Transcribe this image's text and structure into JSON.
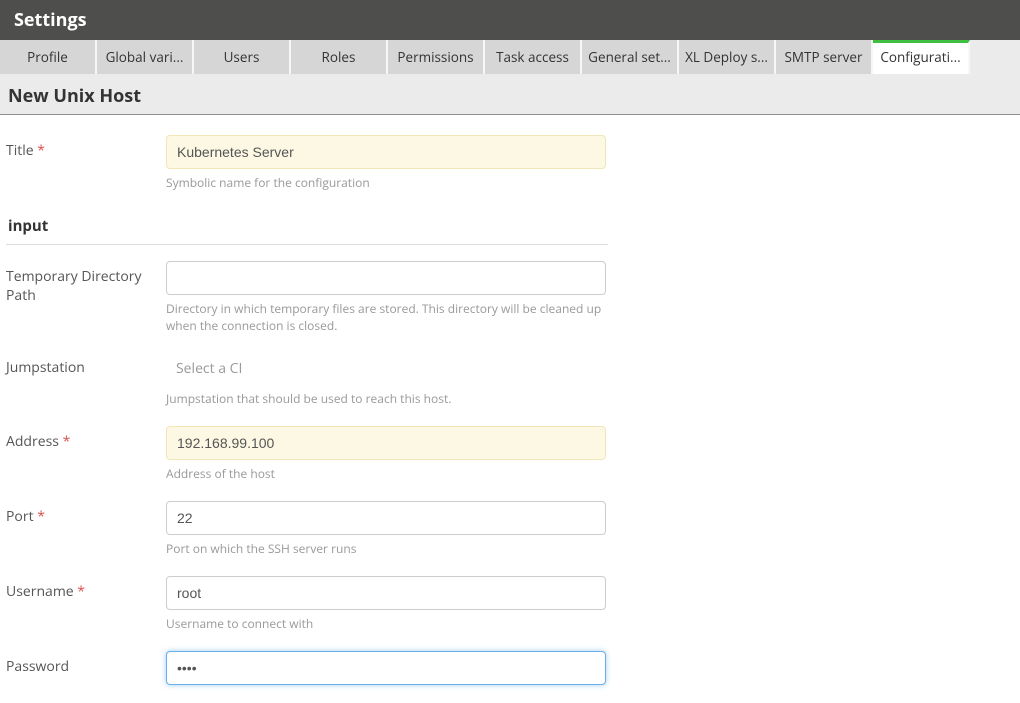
{
  "header": {
    "title": "Settings"
  },
  "tabs": [
    {
      "label": "Profile",
      "active": false
    },
    {
      "label": "Global vari...",
      "active": false
    },
    {
      "label": "Users",
      "active": false
    },
    {
      "label": "Roles",
      "active": false
    },
    {
      "label": "Permissions",
      "active": false
    },
    {
      "label": "Task access",
      "active": false
    },
    {
      "label": "General set...",
      "active": false
    },
    {
      "label": "XL Deploy s...",
      "active": false
    },
    {
      "label": "SMTP server",
      "active": false
    },
    {
      "label": "Configurati...",
      "active": true
    }
  ],
  "page": {
    "title": "New Unix Host"
  },
  "form": {
    "title": {
      "label": "Title",
      "required": true,
      "value": "Kubernetes Server",
      "help": "Symbolic name for the configuration"
    },
    "section_input": "input",
    "tmpDir": {
      "label": "Temporary Directory Path",
      "required": false,
      "value": "",
      "help": "Directory in which temporary files are stored. This directory will be cleaned up when the connection is closed."
    },
    "jumpstation": {
      "label": "Jumpstation",
      "required": false,
      "placeholder": "Select a CI",
      "help": "Jumpstation that should be used to reach this host."
    },
    "address": {
      "label": "Address",
      "required": true,
      "value": "192.168.99.100",
      "help": "Address of the host"
    },
    "port": {
      "label": "Port",
      "required": true,
      "value": "22",
      "help": "Port on which the SSH server runs"
    },
    "username": {
      "label": "Username",
      "required": true,
      "value": "root",
      "help": "Username to connect with"
    },
    "password": {
      "label": "Password",
      "required": false,
      "value": "••••"
    }
  }
}
